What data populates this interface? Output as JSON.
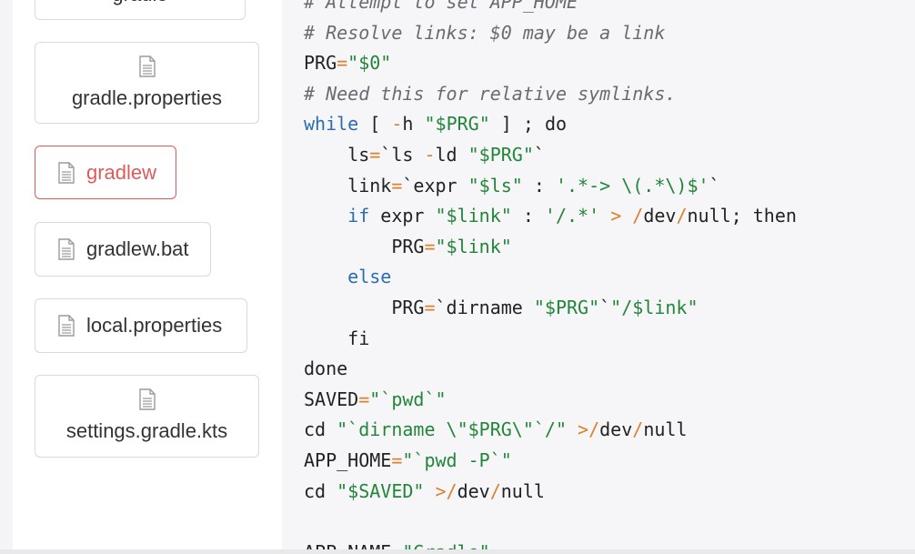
{
  "sidebar": {
    "files": [
      {
        "label": "gradle",
        "icon": "file-icon",
        "active": false,
        "layout": "stacked"
      },
      {
        "label": "gradle.properties",
        "icon": "file-icon",
        "active": false,
        "layout": "stacked"
      },
      {
        "label": "gradlew",
        "icon": "file-icon",
        "active": true,
        "layout": "inline"
      },
      {
        "label": "gradlew.bat",
        "icon": "file-icon",
        "active": false,
        "layout": "inline"
      },
      {
        "label": "local.properties",
        "icon": "file-icon",
        "active": false,
        "layout": "inline"
      },
      {
        "label": "settings.gradle.kts",
        "icon": "file-icon",
        "active": false,
        "layout": "stacked"
      }
    ]
  },
  "colors": {
    "active": "#e05a5a",
    "comment": "#6a6a72",
    "string": "#22863a",
    "operator": "#d9822b",
    "keyword": "#2b6cb0"
  },
  "code": {
    "lines": [
      [
        {
          "t": "c",
          "v": "# Attempt to set APP_HOME"
        }
      ],
      [
        {
          "t": "c",
          "v": "# Resolve links: $0 may be a link"
        }
      ],
      [
        {
          "t": "p",
          "v": "PRG"
        },
        {
          "t": "o",
          "v": "="
        },
        {
          "t": "s",
          "v": "\"$0\""
        }
      ],
      [
        {
          "t": "c",
          "v": "# Need this for relative symlinks."
        }
      ],
      [
        {
          "t": "k",
          "v": "while"
        },
        {
          "t": "p",
          "v": " [ "
        },
        {
          "t": "o",
          "v": "-"
        },
        {
          "t": "p",
          "v": "h "
        },
        {
          "t": "s",
          "v": "\"$PRG\""
        },
        {
          "t": "p",
          "v": " ] ; do"
        }
      ],
      [
        {
          "t": "p",
          "v": "    ls"
        },
        {
          "t": "o",
          "v": "="
        },
        {
          "t": "p",
          "v": "`ls "
        },
        {
          "t": "o",
          "v": "-"
        },
        {
          "t": "p",
          "v": "ld "
        },
        {
          "t": "s",
          "v": "\"$PRG\""
        },
        {
          "t": "p",
          "v": "`"
        }
      ],
      [
        {
          "t": "p",
          "v": "    link"
        },
        {
          "t": "o",
          "v": "="
        },
        {
          "t": "p",
          "v": "`expr "
        },
        {
          "t": "s",
          "v": "\"$ls\""
        },
        {
          "t": "p",
          "v": " : "
        },
        {
          "t": "s",
          "v": "'.*-> \\(.*\\)$'"
        },
        {
          "t": "p",
          "v": "`"
        }
      ],
      [
        {
          "t": "k",
          "v": "    if"
        },
        {
          "t": "p",
          "v": " expr "
        },
        {
          "t": "s",
          "v": "\"$link\""
        },
        {
          "t": "p",
          "v": " : "
        },
        {
          "t": "s",
          "v": "'/.*'"
        },
        {
          "t": "p",
          "v": " "
        },
        {
          "t": "o",
          "v": ">"
        },
        {
          "t": "p",
          "v": " "
        },
        {
          "t": "o",
          "v": "/"
        },
        {
          "t": "p",
          "v": "dev"
        },
        {
          "t": "o",
          "v": "/"
        },
        {
          "t": "p",
          "v": "null; then"
        }
      ],
      [
        {
          "t": "p",
          "v": "        PRG"
        },
        {
          "t": "o",
          "v": "="
        },
        {
          "t": "s",
          "v": "\"$link\""
        }
      ],
      [
        {
          "t": "k",
          "v": "    else"
        }
      ],
      [
        {
          "t": "p",
          "v": "        PRG"
        },
        {
          "t": "o",
          "v": "="
        },
        {
          "t": "p",
          "v": "`dirname "
        },
        {
          "t": "s",
          "v": "\"$PRG\""
        },
        {
          "t": "p",
          "v": "`"
        },
        {
          "t": "s",
          "v": "\"/$link\""
        }
      ],
      [
        {
          "t": "p",
          "v": "    fi"
        }
      ],
      [
        {
          "t": "p",
          "v": "done"
        }
      ],
      [
        {
          "t": "p",
          "v": "SAVED"
        },
        {
          "t": "o",
          "v": "="
        },
        {
          "t": "s",
          "v": "\"`pwd`\""
        }
      ],
      [
        {
          "t": "p",
          "v": "cd "
        },
        {
          "t": "s",
          "v": "\"`dirname \\\"$PRG\\\"`/\""
        },
        {
          "t": "p",
          "v": " "
        },
        {
          "t": "o",
          "v": ">/"
        },
        {
          "t": "p",
          "v": "dev"
        },
        {
          "t": "o",
          "v": "/"
        },
        {
          "t": "p",
          "v": "null"
        }
      ],
      [
        {
          "t": "p",
          "v": "APP_HOME"
        },
        {
          "t": "o",
          "v": "="
        },
        {
          "t": "s",
          "v": "\"`pwd -P`\""
        }
      ],
      [
        {
          "t": "p",
          "v": "cd "
        },
        {
          "t": "s",
          "v": "\"$SAVED\""
        },
        {
          "t": "p",
          "v": " "
        },
        {
          "t": "o",
          "v": ">/"
        },
        {
          "t": "p",
          "v": "dev"
        },
        {
          "t": "o",
          "v": "/"
        },
        {
          "t": "p",
          "v": "null"
        }
      ],
      [
        {
          "t": "p",
          "v": ""
        }
      ],
      [
        {
          "t": "p",
          "v": "APP_NAME"
        },
        {
          "t": "o",
          "v": "="
        },
        {
          "t": "s",
          "v": "\"Gradle\""
        }
      ]
    ]
  }
}
